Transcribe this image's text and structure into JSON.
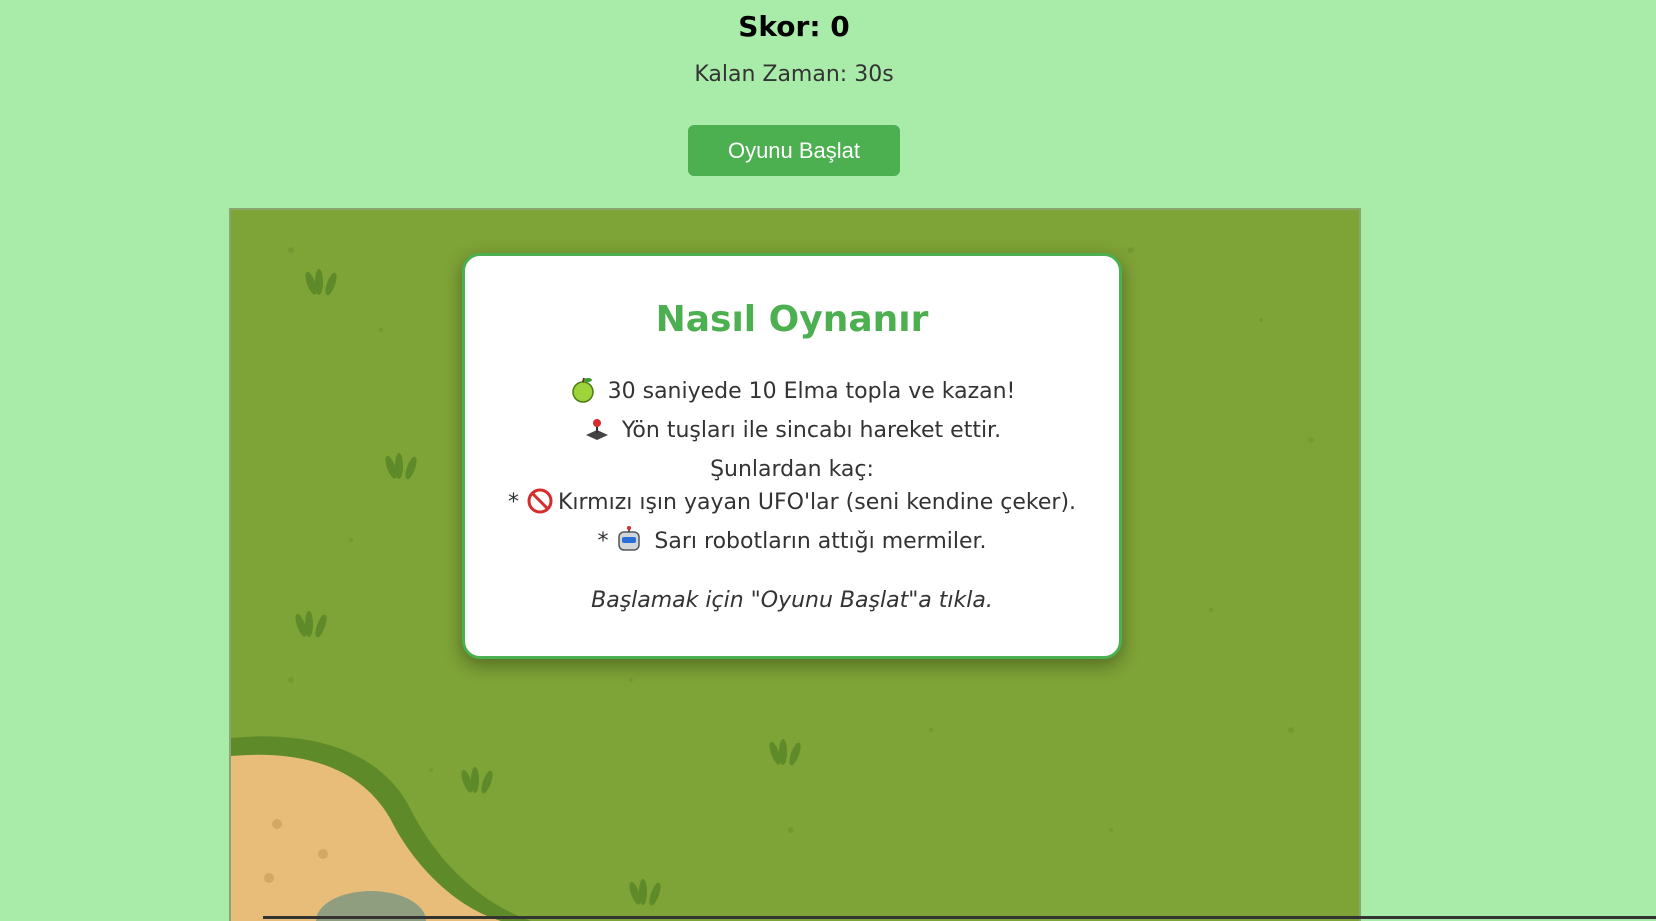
{
  "hud": {
    "score_label": "Skor: 0",
    "timer_label": "Kalan Zaman: 30s",
    "start_button": "Oyunu Başlat"
  },
  "modal": {
    "title": "Nasıl Oynanır",
    "rules": [
      {
        "icon": "apple-icon",
        "prefix": "",
        "text": " 30 saniyede 10 Elma topla ve kazan!"
      },
      {
        "icon": "joystick-icon",
        "prefix": "",
        "text": " Yön tuşları ile sincabı hareket ettir."
      },
      {
        "icon": "",
        "prefix": "",
        "text": "Şunlardan kaç:"
      },
      {
        "icon": "no-entry-icon",
        "prefix": "* ",
        "text": "Kırmızı ışın yayan UFO'lar (seni kendine çeker)."
      },
      {
        "icon": "robot-icon",
        "prefix": "* ",
        "text": " Sarı robotların attığı mermiler."
      }
    ],
    "hint": "Başlamak için \"Oyunu Başlat\"a tıkla."
  },
  "colors": {
    "page_background": "#a9eca9",
    "accent_green": "#4caf50",
    "grass": "#7ea336",
    "sand": "#e8bd7a"
  }
}
